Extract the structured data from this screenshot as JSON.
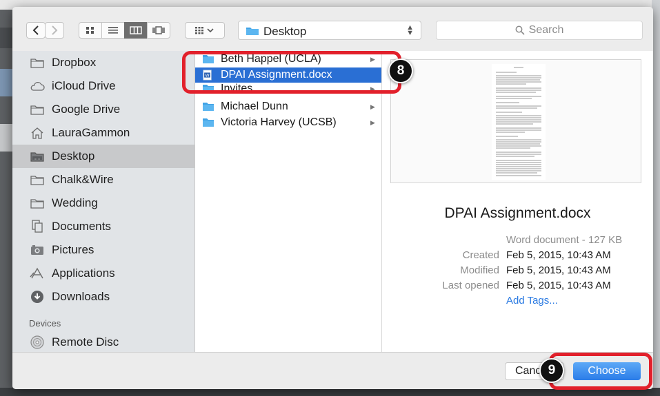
{
  "toolbar": {
    "location": "Desktop",
    "search_placeholder": "Search"
  },
  "sidebar": {
    "favorites": [
      {
        "label": "Dropbox",
        "icon": "folder-icon"
      },
      {
        "label": "iCloud Drive",
        "icon": "cloud-icon"
      },
      {
        "label": "Google Drive",
        "icon": "folder-icon"
      },
      {
        "label": "LauraGammon",
        "icon": "home-icon"
      },
      {
        "label": "Desktop",
        "icon": "desktop-folder-icon",
        "selected": true
      },
      {
        "label": "Chalk&Wire",
        "icon": "folder-icon"
      },
      {
        "label": "Wedding",
        "icon": "folder-icon"
      },
      {
        "label": "Documents",
        "icon": "documents-icon"
      },
      {
        "label": "Pictures",
        "icon": "camera-icon"
      },
      {
        "label": "Applications",
        "icon": "applications-icon"
      },
      {
        "label": "Downloads",
        "icon": "download-icon"
      }
    ],
    "devices_header": "Devices",
    "devices": [
      {
        "label": "Remote Disc",
        "icon": "disc-icon"
      }
    ]
  },
  "browser": {
    "items": [
      {
        "label": "Beth Happel (UCLA)",
        "type": "folder",
        "has_children": true
      },
      {
        "label": "DPAI Assignment.docx",
        "type": "docx",
        "selected": true
      },
      {
        "label": "Invites",
        "type": "folder",
        "has_children": true
      },
      {
        "label": "Michael Dunn",
        "type": "folder",
        "has_children": true
      },
      {
        "label": "Victoria Harvey (UCSB)",
        "type": "folder",
        "has_children": true
      }
    ]
  },
  "preview": {
    "filename": "DPAI Assignment.docx",
    "kind": "Word document - 127 KB",
    "created_label": "Created",
    "created": "Feb 5, 2015, 10:43 AM",
    "modified_label": "Modified",
    "modified": "Feb 5, 2015, 10:43 AM",
    "last_opened_label": "Last opened",
    "last_opened": "Feb 5, 2015, 10:43 AM",
    "add_tags": "Add Tags..."
  },
  "buttons": {
    "cancel": "Cancel",
    "choose": "Choose"
  },
  "annotations": {
    "step8": "8",
    "step9": "9"
  },
  "colors": {
    "selection": "#2a6fd4",
    "accent": "#2a7ce8",
    "highlight": "#e2202b"
  }
}
